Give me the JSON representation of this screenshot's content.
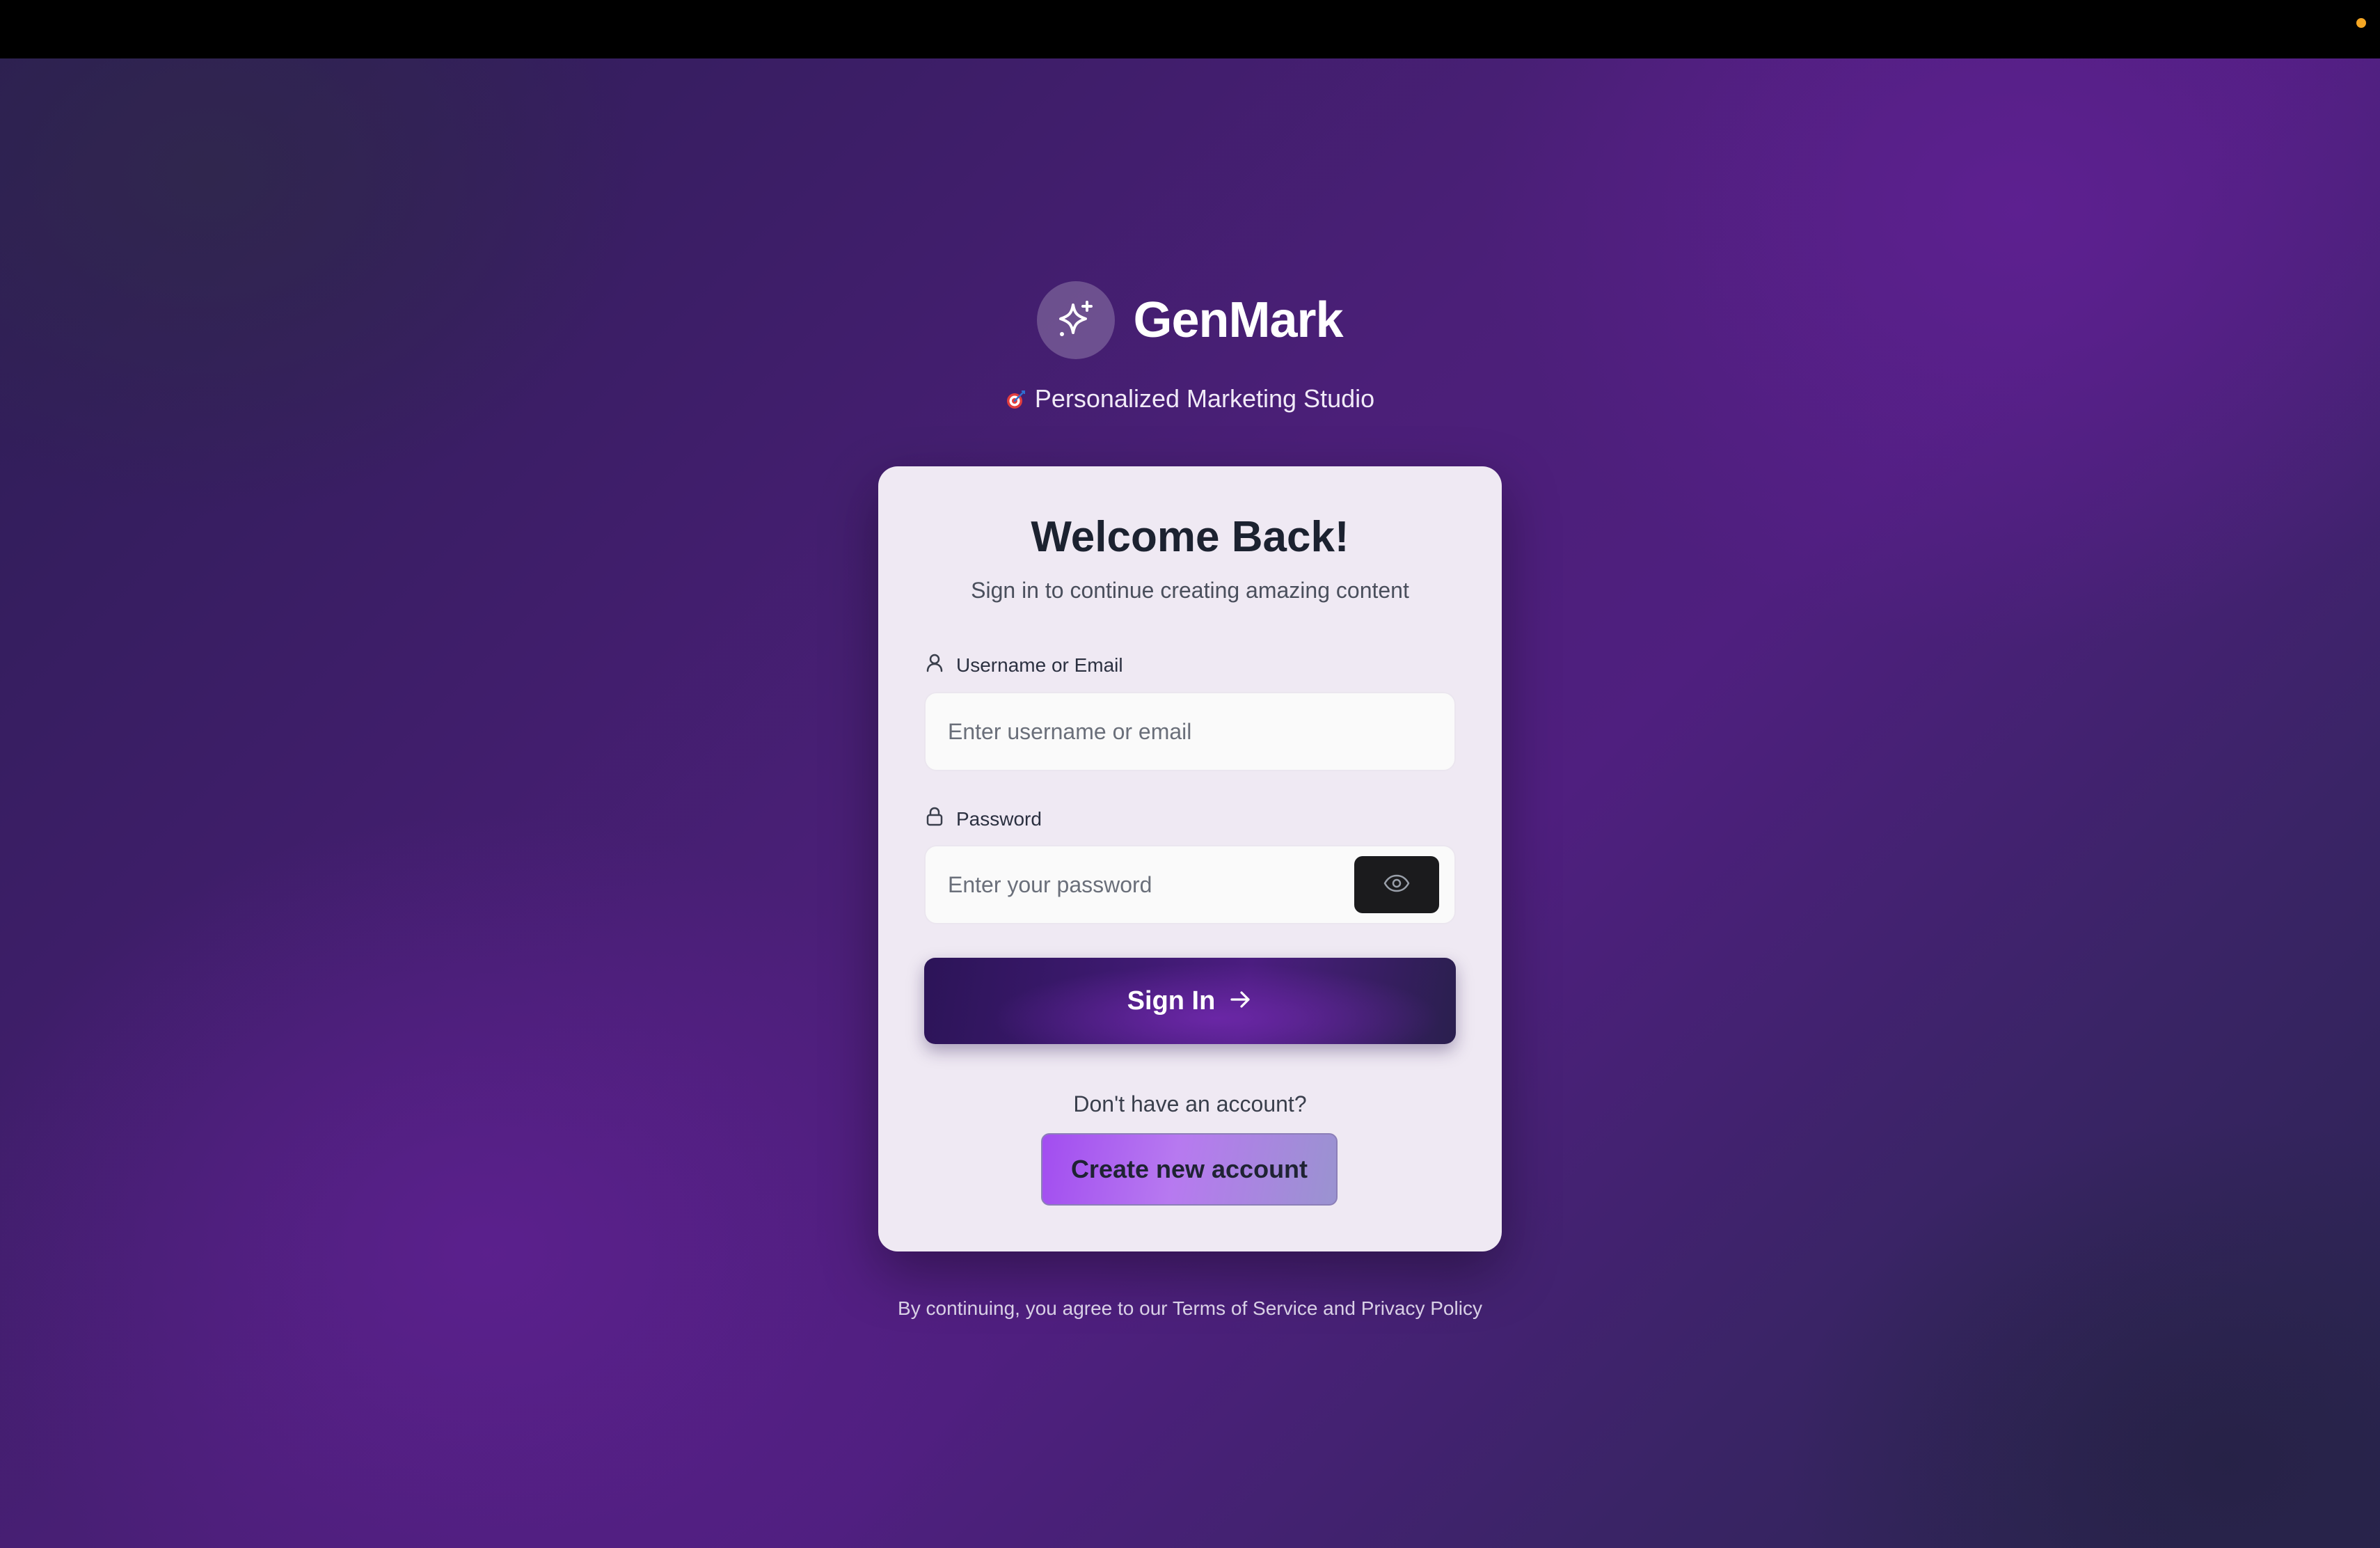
{
  "brand": {
    "name": "GenMark",
    "logo_icon": "sparkles-icon",
    "tagline_icon": "dart-target-icon",
    "tagline": "Personalized Marketing Studio"
  },
  "card": {
    "title": "Welcome Back!",
    "subtitle": "Sign in to continue creating amazing content"
  },
  "username": {
    "label": "Username or Email",
    "icon": "user-icon",
    "value": "",
    "placeholder": "Enter username or email"
  },
  "password": {
    "label": "Password",
    "icon": "lock-icon",
    "value": "",
    "placeholder": "Enter your password",
    "toggle_icon": "eye-icon"
  },
  "sign_in": {
    "label": "Sign In",
    "icon": "arrow-right-icon"
  },
  "signup": {
    "prompt": "Don't have an account?",
    "button_label": "Create new account"
  },
  "legal": {
    "prefix": "By continuing, you agree to our ",
    "terms": "Terms of Service",
    "and": " and ",
    "privacy": "Privacy Policy"
  },
  "colors": {
    "background": "#4b1f78",
    "card": "#efe9f3",
    "topbar": "#000000",
    "status_dot": "#f5a623",
    "sign_in_button": "#3f1a72",
    "create_button": "#a24df0"
  }
}
